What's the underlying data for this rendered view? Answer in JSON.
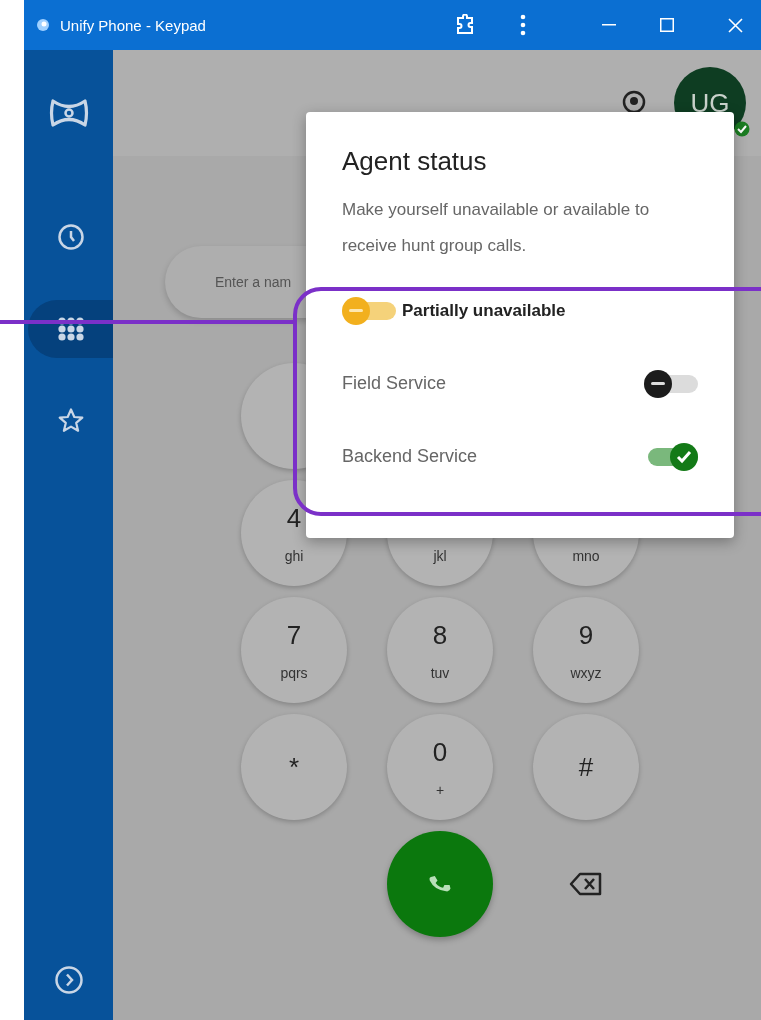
{
  "window": {
    "title": "Unify Phone - Keypad"
  },
  "sidebar": {
    "nav": [
      {
        "kind": "recents",
        "selected": false
      },
      {
        "kind": "keypad",
        "selected": true
      },
      {
        "kind": "favorites",
        "selected": false
      }
    ]
  },
  "header": {
    "avatar": {
      "initials": "UG"
    }
  },
  "search": {
    "placeholder": "Enter a nam"
  },
  "keypad": {
    "rows": [
      [
        {}
      ],
      [
        {
          "digit": "4",
          "letters": "ghi"
        },
        {
          "letters": "jkl"
        },
        {
          "letters": "mno"
        }
      ],
      [
        {
          "digit": "7",
          "letters": "pqrs"
        },
        {
          "digit": "8",
          "letters": "tuv"
        },
        {
          "digit": "9",
          "letters": "wxyz"
        }
      ],
      [
        {
          "digit": "*"
        },
        {
          "digit": "0",
          "letters": "+"
        },
        {
          "digit": "#"
        }
      ]
    ]
  },
  "agent_status": {
    "title": "Agent status",
    "description": "Make yourself unavailable or available to receive hunt group calls.",
    "overall": {
      "label": "Partially unavailable",
      "kind": "partial"
    },
    "groups": [
      {
        "label": "Field Service",
        "on": false
      },
      {
        "label": "Backend Service",
        "on": true
      }
    ]
  }
}
